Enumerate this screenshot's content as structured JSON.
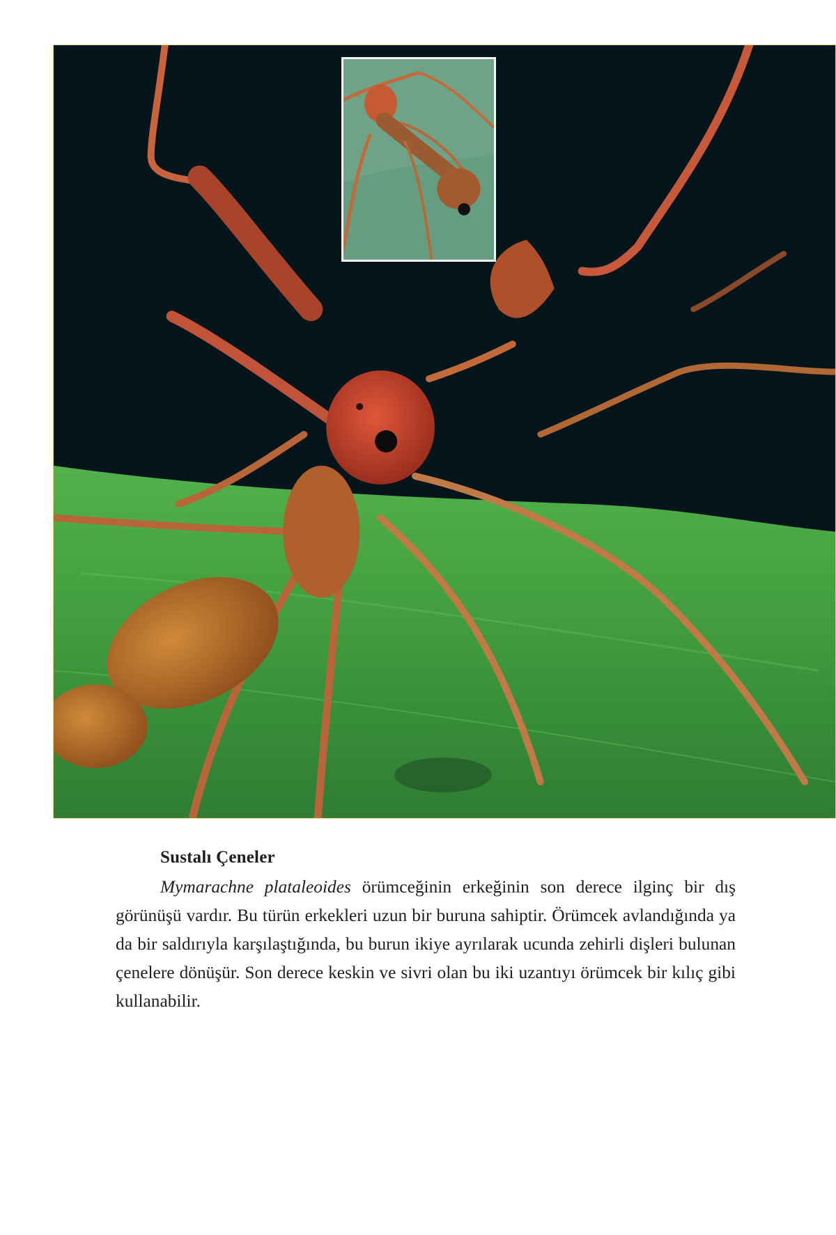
{
  "article": {
    "heading": "Sustalı Çeneler",
    "species_name": "Mymarachne plataleoides",
    "body_text": " örümceğinin erkeğinin son derece ilginç bir dış görünüşü vardır. Bu türün erkekleri uzun bir buruna sahiptir. Örümcek avlandığında ya da bir saldırıyla karşılaştığında, bu burun ikiye ayrılarak ucunda zehirli dişleri bulunan çenelere dönüşür. Son derece keskin ve sivri olan bu iki uzantıyı örümcek bir kılıç gibi kullanabilir."
  },
  "colors": {
    "background_dark": "#06141c",
    "leaf_green": "#3f9a3c",
    "spider_red": "#b8432a",
    "spider_brown": "#a8642a"
  }
}
